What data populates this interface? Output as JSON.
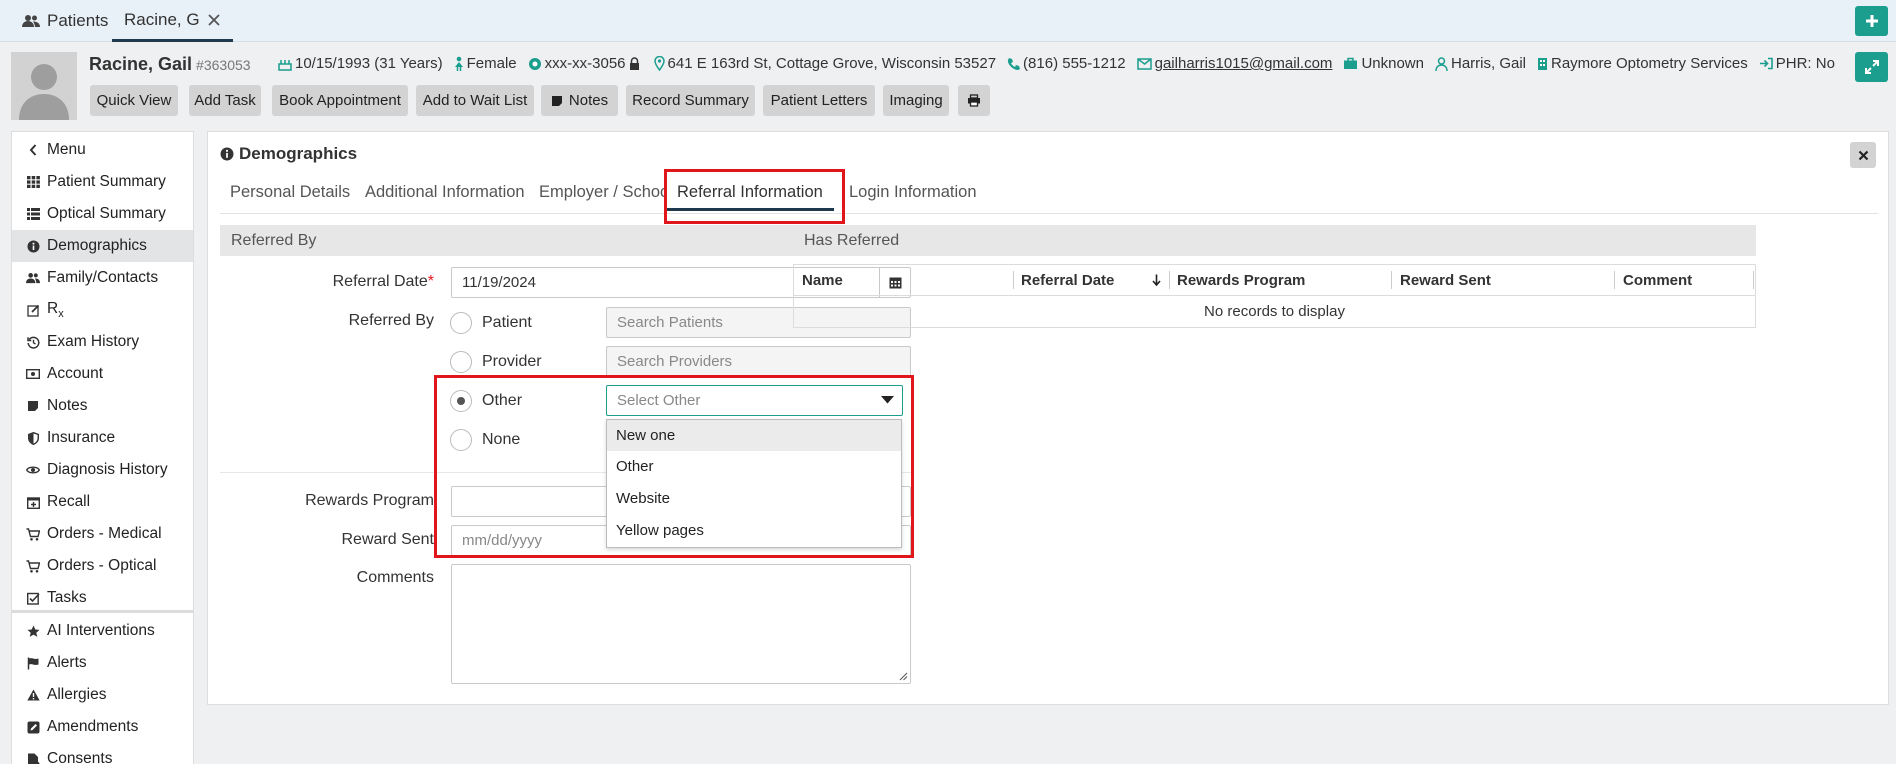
{
  "topbar": {
    "tab_patients": "Patients",
    "tab_patient": "Racine, G"
  },
  "patient": {
    "name": "Racine, Gail",
    "id": "#363053",
    "dob": "10/15/1993 (31 Years)",
    "gender": "Female",
    "ssn": "xxx-xx-3056",
    "address": "641 E 163rd St, Cottage Grove, Wisconsin 53527",
    "phone": "(816) 555-1212",
    "email": "gailharris1015@gmail.com",
    "employment": "Unknown",
    "provider": "Harris, Gail",
    "location": "Raymore Optometry Services",
    "phr": "PHR: No"
  },
  "actions": {
    "quick_view": "Quick View",
    "add_task": "Add Task",
    "book_appointment": "Book Appointment",
    "add_wait_list": "Add to Wait List",
    "notes": "Notes",
    "record_summary": "Record Summary",
    "patient_letters": "Patient Letters",
    "imaging": "Imaging"
  },
  "sidebar": {
    "items": [
      {
        "label": "Menu",
        "icon": "chevron-left-icon"
      },
      {
        "label": "Patient Summary",
        "icon": "grid-icon"
      },
      {
        "label": "Optical Summary",
        "icon": "list-icon"
      },
      {
        "label": "Demographics",
        "icon": "info-icon",
        "active": true
      },
      {
        "label": "Family/Contacts",
        "icon": "users-icon"
      },
      {
        "label": "R",
        "sub": "x",
        "icon": "pencil-square-icon"
      },
      {
        "label": "Exam History",
        "icon": "history-icon"
      },
      {
        "label": "Account",
        "icon": "money-icon"
      },
      {
        "label": "Notes",
        "icon": "note-icon"
      },
      {
        "label": "Insurance",
        "icon": "shield-icon"
      },
      {
        "label": "Diagnosis History",
        "icon": "eye-icon"
      },
      {
        "label": "Recall",
        "icon": "calendar-plus-icon"
      },
      {
        "label": "Orders - Medical",
        "icon": "cart-icon"
      },
      {
        "label": "Orders - Optical",
        "icon": "cart-icon"
      },
      {
        "label": "Tasks",
        "icon": "checkbox-icon"
      },
      {
        "label": "AI Interventions",
        "icon": "star-icon"
      },
      {
        "label": "Alerts",
        "icon": "flag-icon"
      },
      {
        "label": "Allergies",
        "icon": "warning-icon"
      },
      {
        "label": "Amendments",
        "icon": "edit-icon"
      },
      {
        "label": "Consents",
        "icon": "document-icon"
      }
    ]
  },
  "panel": {
    "title": "Demographics",
    "tabs": [
      "Personal Details",
      "Additional Information",
      "Employer / School",
      "Referral Information",
      "Login Information"
    ],
    "active_tab": "Referral Information"
  },
  "referred_by": {
    "section_title": "Referred By",
    "referral_date_label": "Referral Date",
    "referral_date": "11/19/2024",
    "referred_by_label": "Referred By",
    "opt_patient": "Patient",
    "search_patients_placeholder": "Search Patients",
    "opt_provider": "Provider",
    "search_providers_placeholder": "Search Providers",
    "opt_other": "Other",
    "select_other_placeholder": "Select Other",
    "opt_none": "None",
    "selected": "Other",
    "dropdown_options": [
      "New one",
      "Other",
      "Website",
      "Yellow pages"
    ],
    "rewards_program_label": "Rewards Program",
    "reward_sent_label": "Reward Sent",
    "reward_sent_placeholder": "mm/dd/yyyy",
    "comments_label": "Comments"
  },
  "has_referred": {
    "section_title": "Has Referred",
    "columns": [
      "Name",
      "Referral Date",
      "Rewards Program",
      "Reward Sent",
      "Comment"
    ],
    "empty_text": "No records to display"
  },
  "colors": {
    "accent": "#1b9e8e",
    "highlight": "#e0161b",
    "tab_underline": "#1f3a4f"
  }
}
